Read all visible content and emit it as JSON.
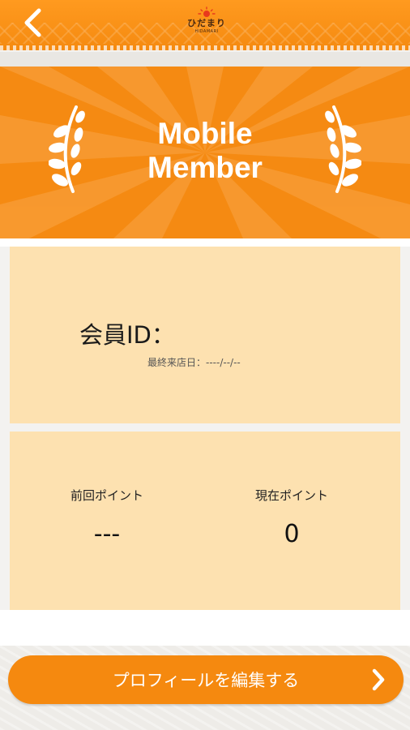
{
  "header": {
    "logo_text": "ひだまり",
    "logo_sub": "HIDAMARI"
  },
  "banner": {
    "title": "Mobile\nMember"
  },
  "member": {
    "id_label": "会員ID：",
    "last_visit": "最終来店日：----/--/--"
  },
  "points": {
    "previous_label": "前回ポイント",
    "previous_value": "---",
    "current_label": "現在ポイント",
    "current_value": "0"
  },
  "footer": {
    "edit_profile_label": "プロフィールを編集する"
  },
  "colors": {
    "accent": "#f58a12",
    "card": "#fde1b0"
  }
}
